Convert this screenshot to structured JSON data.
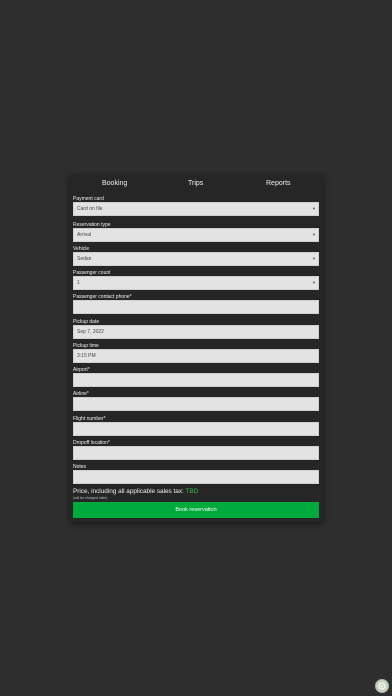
{
  "tabs": [
    {
      "label": "Booking"
    },
    {
      "label": "Trips"
    },
    {
      "label": "Reports"
    }
  ],
  "form": {
    "payment_card": {
      "label": "Payment card",
      "value": "Card on file"
    },
    "reservation_type": {
      "label": "Reservation type",
      "value": "Arrival"
    },
    "vehicle": {
      "label": "Vehicle",
      "value": "Sedan"
    },
    "passenger_count": {
      "label": "Passenger count",
      "value": "1"
    },
    "contact_phone": {
      "label": "Passenger contact phone*",
      "value": ""
    },
    "pickup_date": {
      "label": "Pickup date",
      "value": "Sep 7, 2022"
    },
    "pickup_time": {
      "label": "Pickup time",
      "value": "3:15 PM"
    },
    "airport": {
      "label": "Airport*",
      "value": ""
    },
    "airline": {
      "label": "Airline*",
      "value": ""
    },
    "flight_number": {
      "label": "Flight number*",
      "value": ""
    },
    "dropoff_location": {
      "label": "Dropoff location*",
      "value": ""
    },
    "notes": {
      "label": "Notes",
      "value": ""
    }
  },
  "price": {
    "label": "Price, including all applicable sales tax:",
    "value": "TBD",
    "note": "(will be charged later)"
  },
  "book_button": {
    "label": "Book reservation"
  },
  "colors": {
    "background": "#2e2e2e",
    "card": "#262626",
    "accent": "#00aa3c",
    "tbd": "#2fbf4a"
  },
  "icons": {
    "fab": "help-icon"
  }
}
